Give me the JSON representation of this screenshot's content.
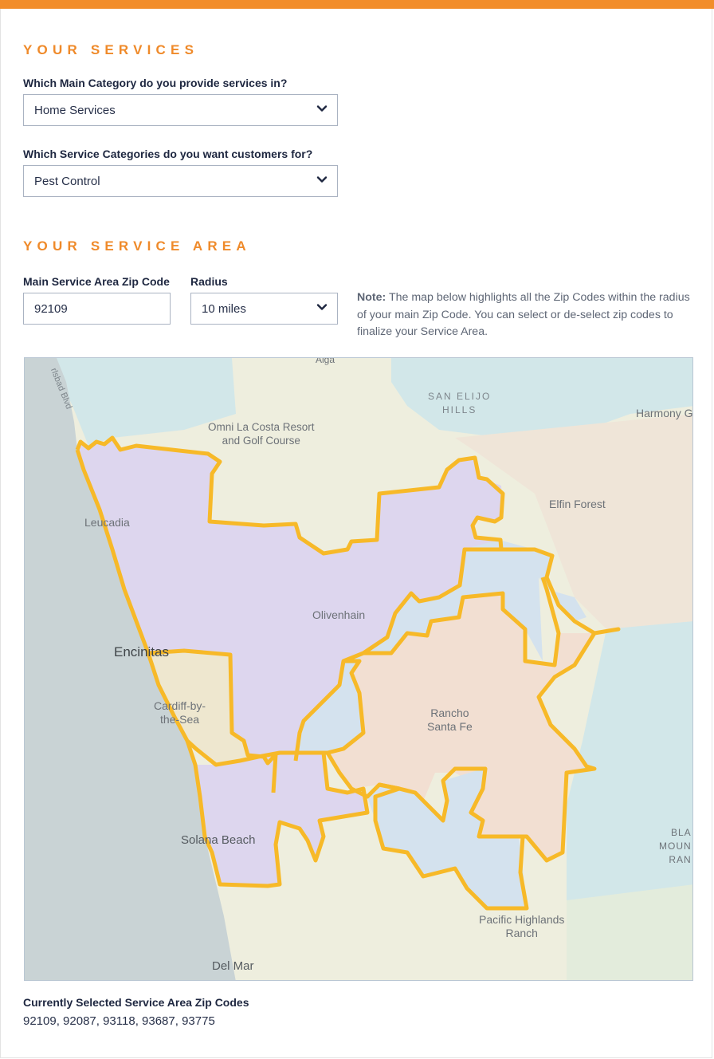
{
  "services": {
    "title": "YOUR SERVICES",
    "main_category_label": "Which Main Category do you provide services in?",
    "main_category_value": "Home Services",
    "service_categories_label": "Which Service Categories do you want customers for?",
    "service_categories_value": "Pest Control"
  },
  "service_area": {
    "title": "YOUR SERVICE AREA",
    "zip_label": "Main Service Area Zip Code",
    "zip_value": "92109",
    "radius_label": "Radius",
    "radius_value": "10 miles",
    "note_bold": "Note:",
    "note_text": " The map below highlights all the Zip Codes within the radius of your main Zip Code. You can select or de-select zip codes to finalize your Service Area."
  },
  "map": {
    "places": {
      "carlsbad_blvd": "rlsbad Blvd",
      "algo": "Alga",
      "omni": "Omni La Costa Resort\nand Golf Course",
      "san_elijo": "SAN ELIJO\nHILLS",
      "harmony": "Harmony G",
      "leucadia": "Leucadia",
      "elfin_forest": "Elfin Forest",
      "olivenhain": "Olivenhain",
      "encinitas": "Encinitas",
      "cardiff": "Cardiff-by-\nthe-Sea",
      "rancho_santa_fe": "Rancho\nSanta Fe",
      "solana_beach": "Solana Beach",
      "black_mountain": "BLA\nMOUN\nRAN",
      "pacific_highlands": "Pacific Highlands\nRanch",
      "del_mar": "Del Mar"
    },
    "colors": {
      "ocean": "#c9d3d5",
      "land": "#eeeede",
      "zone_purple": "#ddd6ee",
      "zone_peach": "#f2dfd2",
      "zone_blue": "#d4e2ee",
      "zone_teal": "#d2e7e9",
      "outline": "#f7b928"
    }
  },
  "selected": {
    "label": "Currently Selected Service Area Zip Codes",
    "value": "92109, 92087, 93118, 93687, 93775"
  }
}
